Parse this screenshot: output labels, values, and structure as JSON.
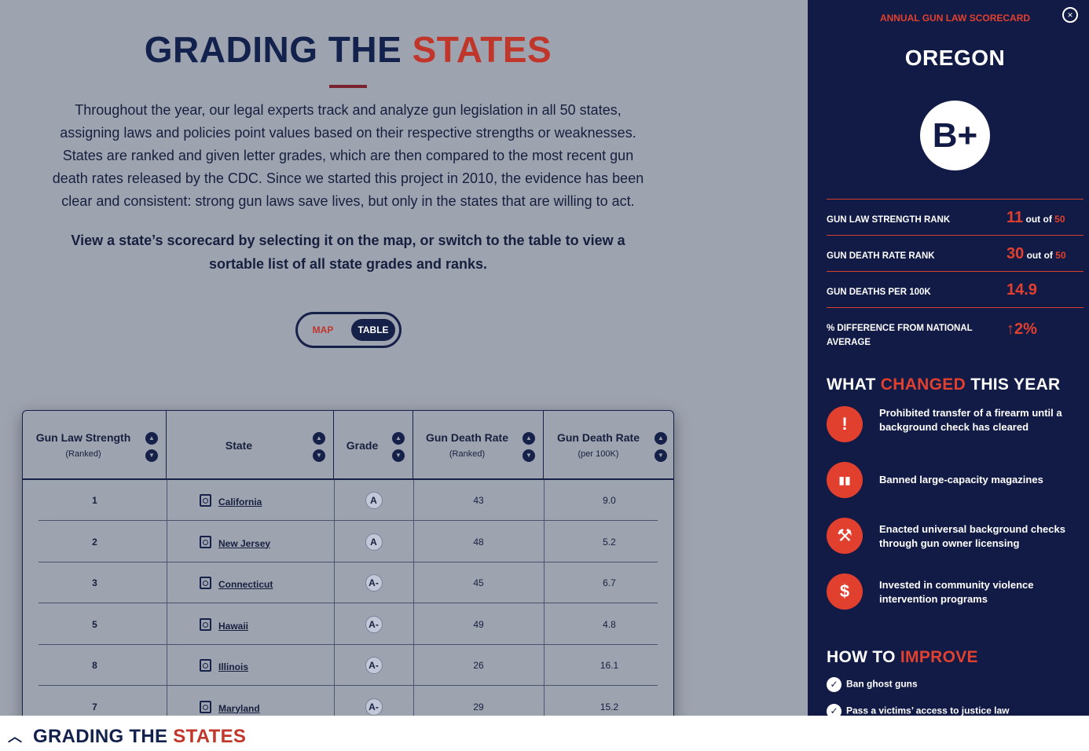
{
  "hero": {
    "title_main": "GRADING THE",
    "title_accent": "STATES",
    "intro": "Throughout the year, our legal experts track and analyze gun legislation in all 50 states, assigning laws and policies point values based on their respective strengths or weaknesses. States are ranked and given letter grades, which are then compared to the most recent gun death rates released by the CDC. Since we started this project in 2010, the evidence has been clear and consistent: strong gun laws save lives, but only in the states that are willing to act.",
    "intro_bold": "View a state’s scorecard by selecting it on the map, or switch to the table to view a sortable list of all state grades and ranks."
  },
  "toggle": {
    "map": "MAP",
    "table": "TABLE",
    "selected": "TABLE"
  },
  "table": {
    "headers": [
      {
        "label": "Gun Law Strength",
        "sub": "(Ranked)"
      },
      {
        "label": "State",
        "sub": ""
      },
      {
        "label": "Grade",
        "sub": ""
      },
      {
        "label": "Gun Death Rate",
        "sub": "(Ranked)"
      },
      {
        "label": "Gun Death Rate",
        "sub": "(per 100K)"
      }
    ],
    "sort_up": "▲",
    "sort_down": "▼",
    "rows": [
      {
        "rank": "1",
        "state": "California",
        "grade": "A",
        "death_rank": "43",
        "death_rate": "9.0"
      },
      {
        "rank": "2",
        "state": "New Jersey",
        "grade": "A",
        "death_rank": "48",
        "death_rate": "5.2"
      },
      {
        "rank": "3",
        "state": "Connecticut",
        "grade": "A-",
        "death_rank": "45",
        "death_rate": "6.7"
      },
      {
        "rank": "5",
        "state": "Hawaii",
        "grade": "A-",
        "death_rank": "49",
        "death_rate": "4.8"
      },
      {
        "rank": "8",
        "state": "Illinois",
        "grade": "A-",
        "death_rank": "26",
        "death_rate": "16.1"
      },
      {
        "rank": "7",
        "state": "Maryland",
        "grade": "A-",
        "death_rank": "29",
        "death_rate": "15.2"
      }
    ]
  },
  "panel": {
    "kicker": "ANNUAL GUN LAW SCORECARD",
    "close_label": "×",
    "state": "OREGON",
    "grade": "B+",
    "stats": [
      {
        "label": "GUN LAW STRENGTH RANK",
        "value": "11",
        "suffix": "out of",
        "total": "50"
      },
      {
        "label": "GUN DEATH RATE RANK",
        "value": "30",
        "suffix": "out of",
        "total": "50"
      },
      {
        "label": "GUN DEATHS PER 100K",
        "value": "14.9",
        "suffix": "",
        "total": ""
      },
      {
        "label": "% DIFFERENCE FROM NATIONAL AVERAGE",
        "value": "↑2%",
        "suffix": "",
        "total": ""
      }
    ],
    "changed_title": {
      "a": "WHAT",
      "accent": "CHANGED",
      "b": "THIS YEAR"
    },
    "changes": [
      {
        "icon": "exclamation-icon",
        "glyph": "!",
        "text": "Prohibited transfer of a firearm until a background check has cleared"
      },
      {
        "icon": "magazine-icon",
        "glyph": "▮▮",
        "text": "Banned large-capacity magazines"
      },
      {
        "icon": "gavel-icon",
        "glyph": "⚒",
        "text": "Enacted universal background checks through gun owner licensing"
      },
      {
        "icon": "money-cycle-icon",
        "glyph": "$",
        "text": "Invested in community violence intervention programs"
      }
    ],
    "improve_title": {
      "a": "HOW TO",
      "accent": "IMPROVE"
    },
    "improve": [
      {
        "text": "Ban ghost guns"
      },
      {
        "text": "Pass a victims’ access to justice law"
      }
    ],
    "check_glyph": "✓"
  },
  "bottom": {
    "chevron": "︿",
    "title_main": "GRADING THE",
    "title_accent": "STATES"
  },
  "colors": {
    "navy": "#111b45",
    "red": "#e2402f",
    "overlay": "#9ea3b0"
  }
}
